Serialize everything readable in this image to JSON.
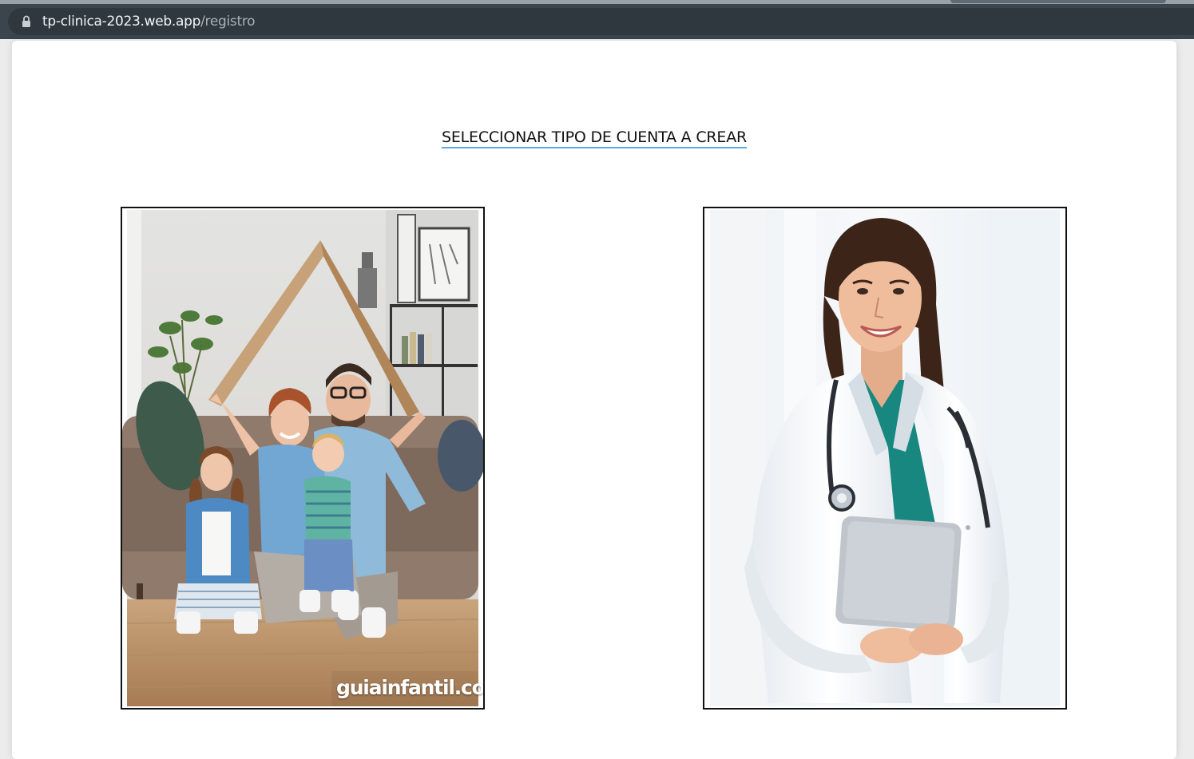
{
  "browser": {
    "url_host": "tp-clinica-2023.web.app",
    "url_path": "/registro"
  },
  "main": {
    "heading": "SELECCIONAR TIPO DE CUENTA A CREAR",
    "options": [
      {
        "id": "paciente",
        "image": "family-under-roof-photo",
        "watermark": "guiainfantil.com"
      },
      {
        "id": "especialista",
        "image": "doctor-with-stethoscope-photo"
      }
    ]
  }
}
